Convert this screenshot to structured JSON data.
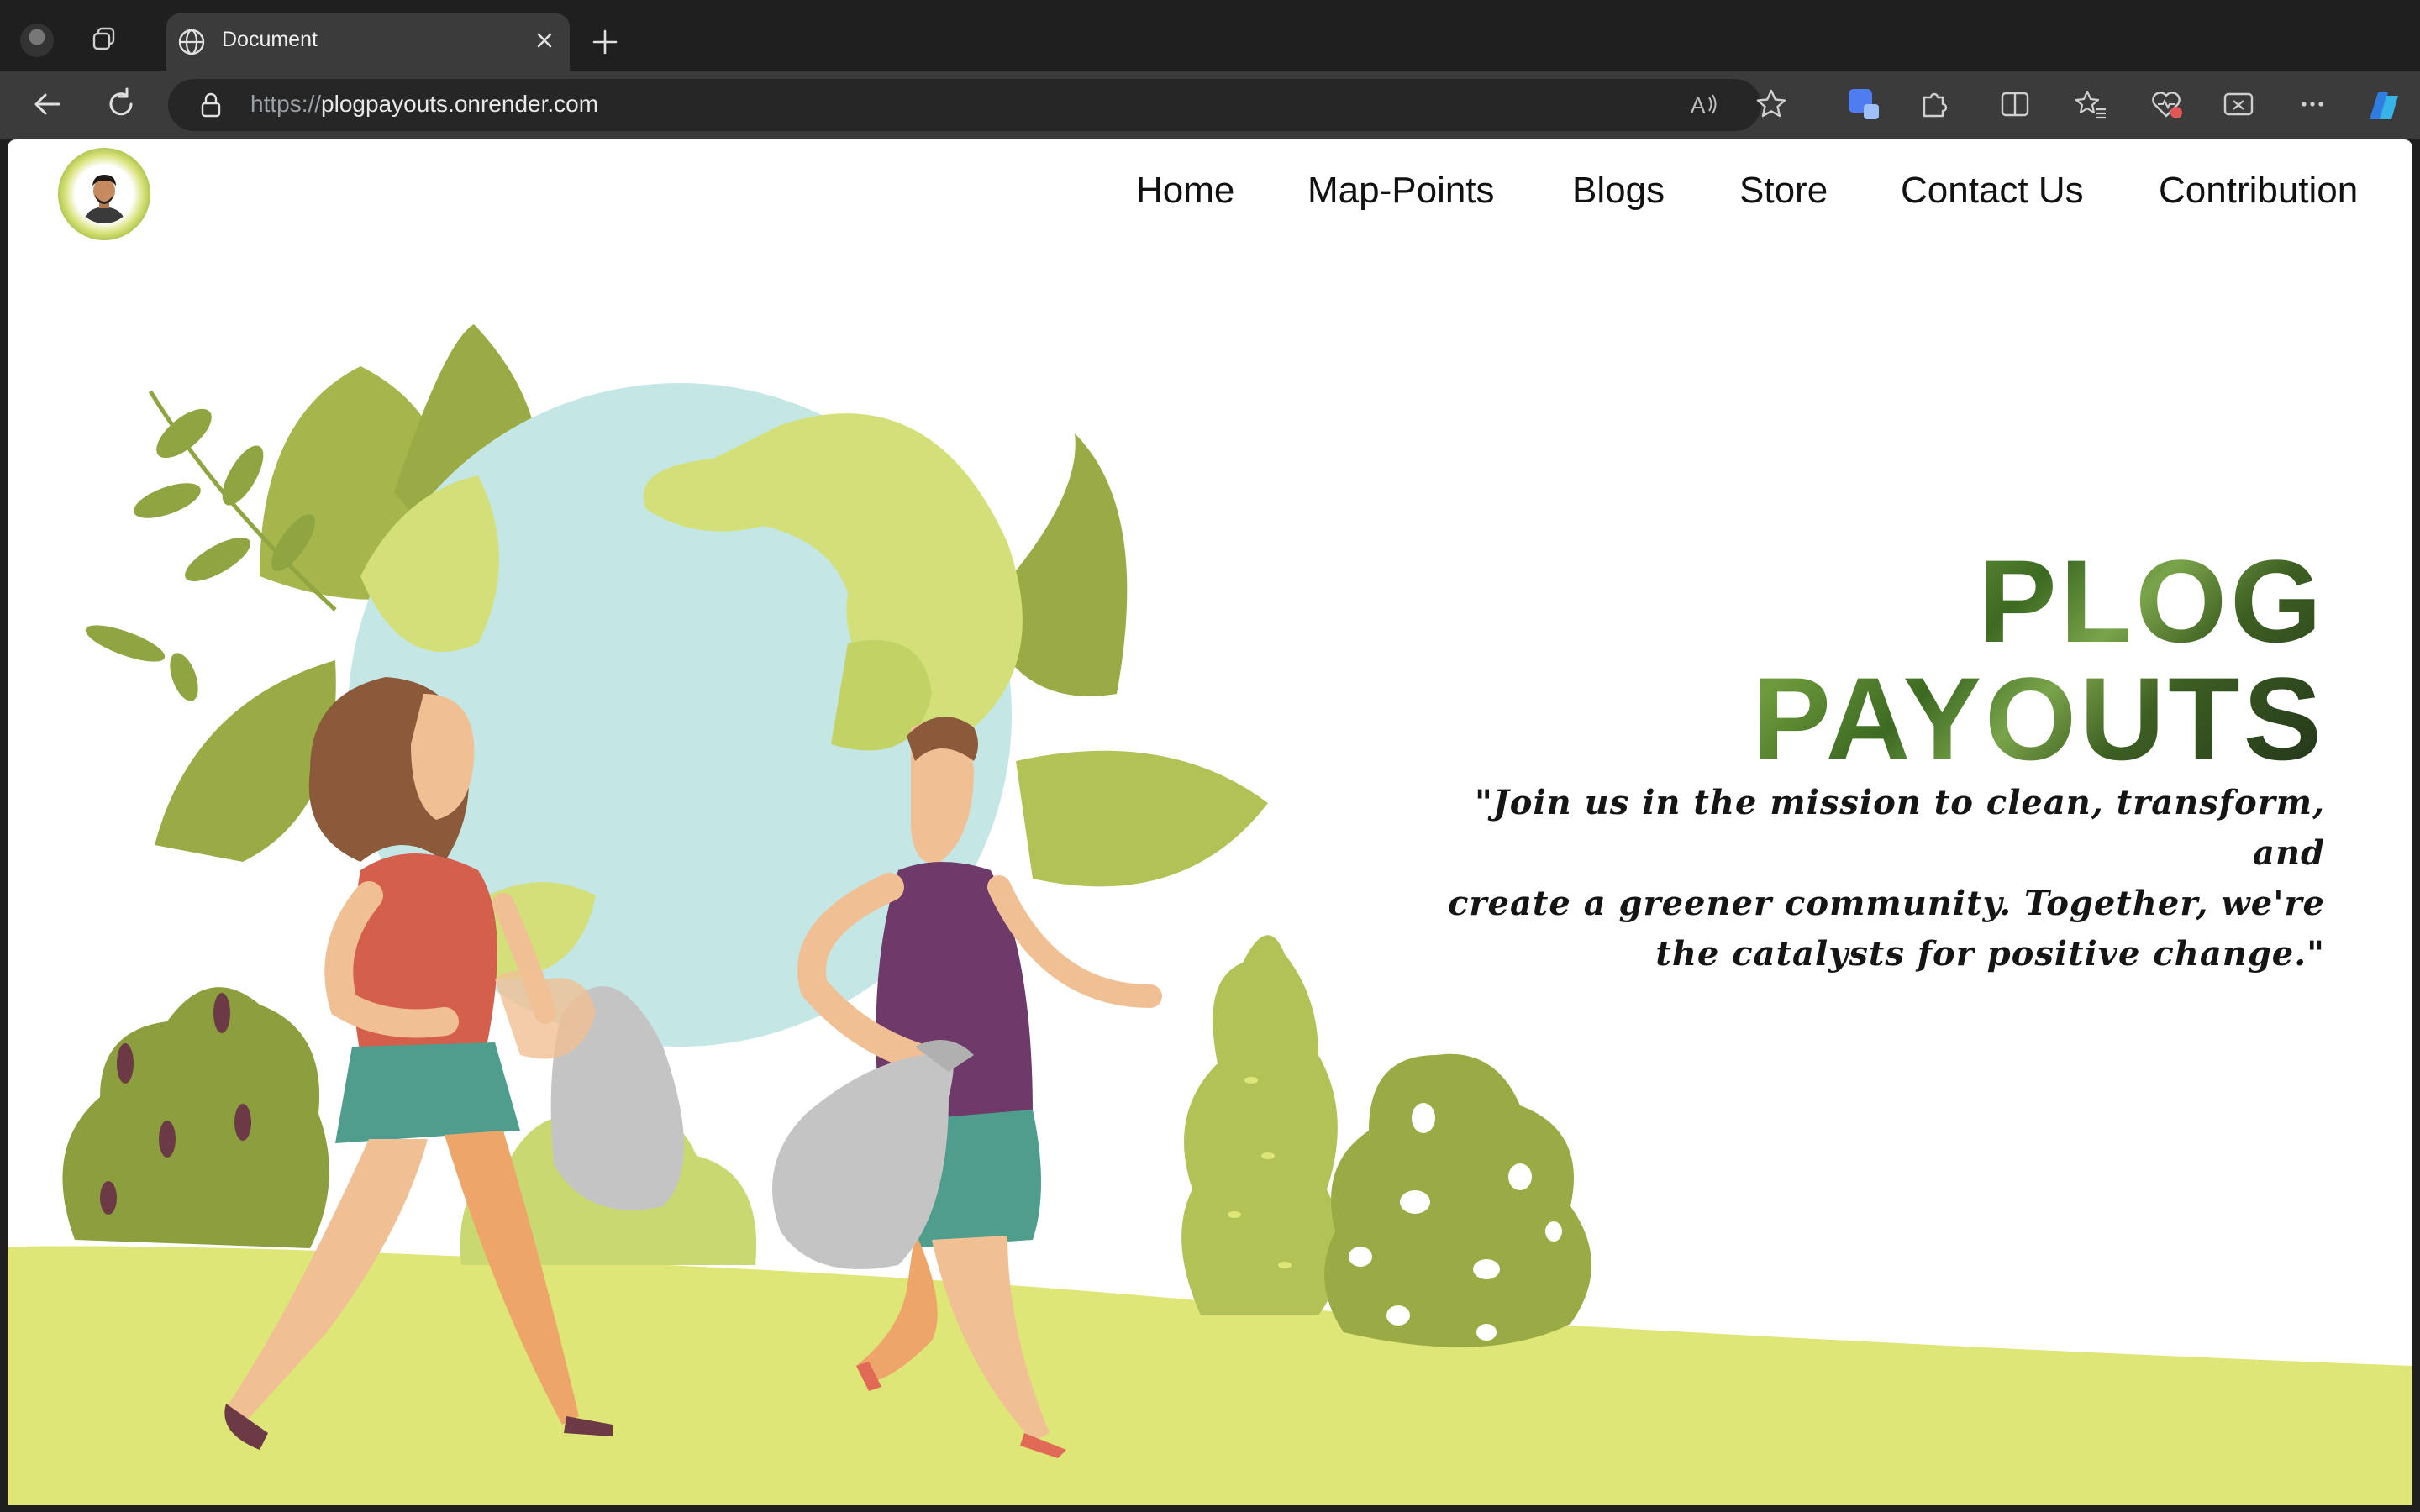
{
  "browser": {
    "tab_title": "Document",
    "url_scheme": "https://",
    "url_host": "plogpayouts.onrender.com",
    "icons": [
      "profile-icon",
      "workspaces-icon",
      "globe-icon",
      "close-icon",
      "plus-icon",
      "back-icon",
      "refresh-icon",
      "lock-icon",
      "read-aloud-icon",
      "favorite-star-icon",
      "extension-icon",
      "puzzle-icon",
      "split-screen-icon",
      "favorites-icon",
      "browser-essentials-icon",
      "screenshot-icon",
      "more-icon",
      "copilot-icon"
    ]
  },
  "nav": {
    "home": "Home",
    "map_points": "Map-Points",
    "blogs": "Blogs",
    "store": "Store",
    "contact": "Contact Us",
    "contribution": "Contribution"
  },
  "hero": {
    "title_line1": "PLOG",
    "title_line2": "PAYOUTS",
    "quote_line1": "\"Join us in the mission to clean, transform, and",
    "quote_line2": "create a greener community. Together, we're",
    "quote_line3": "the catalysts for positive change.\""
  },
  "colors": {
    "grass": "#dde677",
    "earth_water": "#c4e7e6",
    "earth_land": "#d3e07a",
    "leaf_dark": "#9aab45",
    "leaf_mid": "#b2c257",
    "bag_gray": "#c4c4c4",
    "man_shirt": "#6d3a6a",
    "shorts_teal": "#4f9d8c",
    "skin": "#f0c094"
  }
}
